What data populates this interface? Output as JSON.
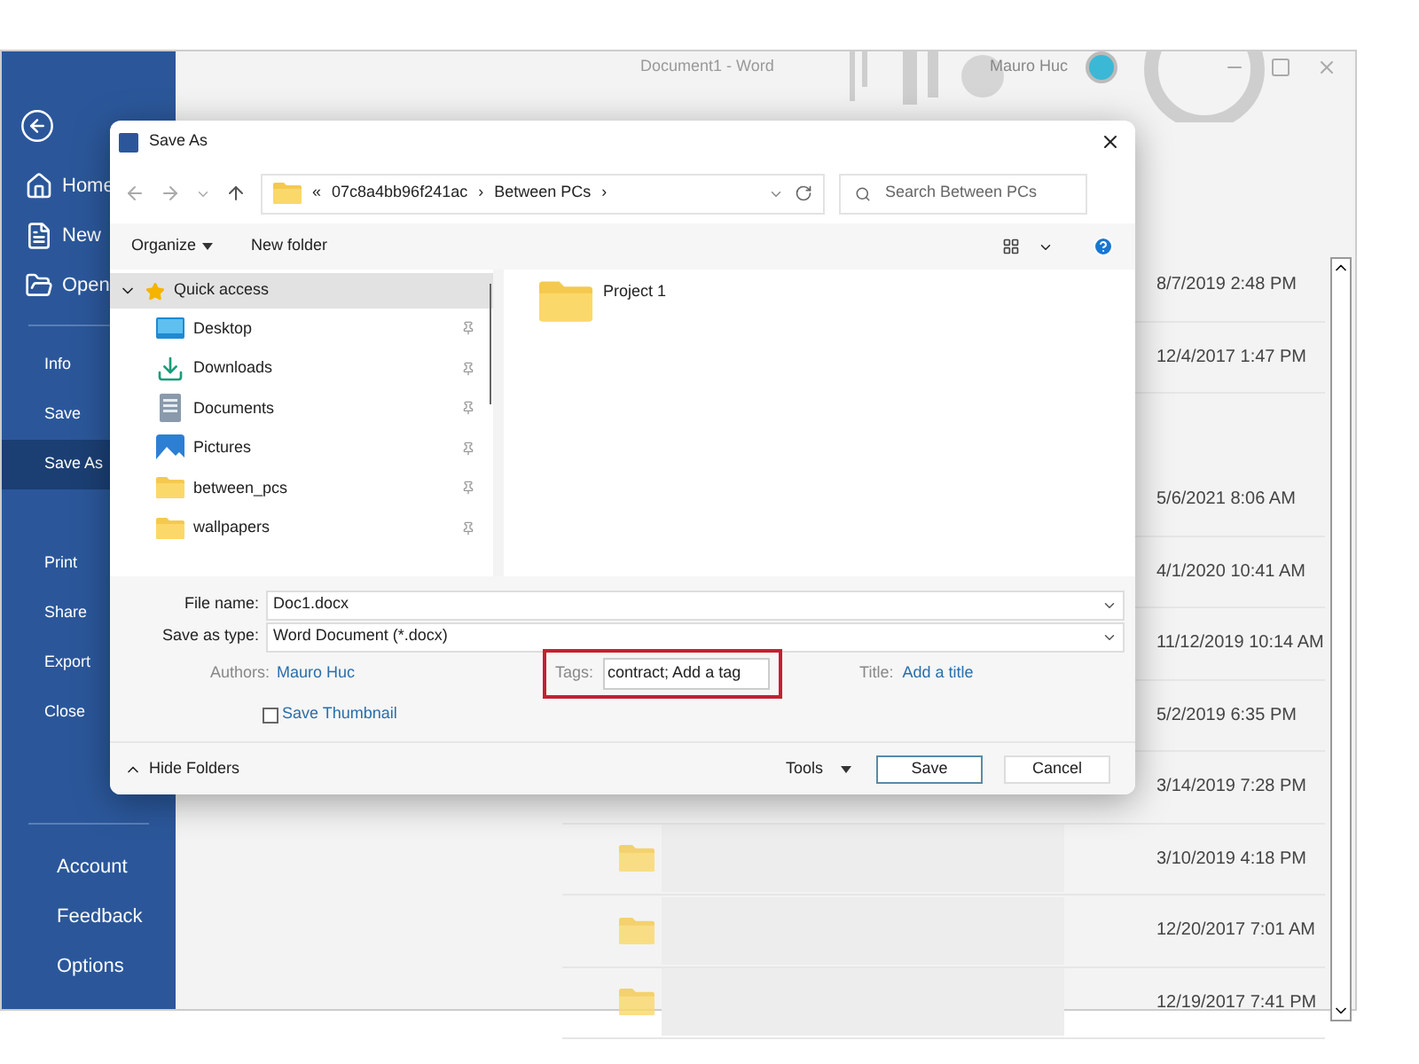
{
  "word": {
    "title": "Document1 - Word",
    "user": "Mauro Huc",
    "nav_top": [
      {
        "label": "Home",
        "kind": "home"
      },
      {
        "label": "New",
        "kind": "new"
      },
      {
        "label": "Open",
        "kind": "open"
      }
    ],
    "nav_middle": [
      {
        "label": "Info",
        "selected": false
      },
      {
        "label": "Save",
        "selected": false
      },
      {
        "label": "Save As",
        "selected": true
      },
      {
        "label": "Print",
        "selected": false
      },
      {
        "label": "Share",
        "selected": false
      },
      {
        "label": "Export",
        "selected": false
      },
      {
        "label": "Close",
        "selected": false
      }
    ],
    "nav_bottom": [
      "Account",
      "Feedback",
      "Options"
    ],
    "recent_first": [
      {
        "date": "8/7/2019 2:48 PM"
      },
      {
        "date": "12/4/2017 1:47 PM"
      }
    ],
    "recent_second": [
      {
        "date": "5/6/2021 8:06 AM"
      },
      {
        "date": "4/1/2020 10:41 AM"
      },
      {
        "date": "11/12/2019 10:14 AM"
      },
      {
        "date": "5/2/2019 6:35 PM"
      },
      {
        "date": "3/14/2019 7:28 PM"
      }
    ],
    "recent_folders": [
      {
        "date": "3/10/2019 4:18 PM"
      },
      {
        "date": "12/20/2017 7:01 AM"
      },
      {
        "date": "12/19/2017 7:41 PM"
      }
    ]
  },
  "dialog": {
    "title": "Save As",
    "path": [
      "«",
      "07c8a4bb96f241ac",
      "›",
      "Between PCs",
      "›"
    ],
    "search": {
      "placeholder": "Search Between PCs"
    },
    "toolbar": [
      "Organize",
      "New folder"
    ],
    "nav": {
      "label": "Quick access",
      "expanded": true,
      "selected": true,
      "children": [
        {
          "label": "Desktop",
          "kind": "desktop"
        },
        {
          "label": "Downloads",
          "kind": "downloads"
        },
        {
          "label": "Documents",
          "kind": "documents"
        },
        {
          "label": "Pictures",
          "kind": "pictures"
        },
        {
          "label": "between_pcs",
          "kind": "folder"
        },
        {
          "label": "wallpapers",
          "kind": "folder"
        }
      ]
    },
    "files": [
      {
        "name": "Project 1"
      }
    ],
    "file_name": {
      "label": "File name:",
      "value": "Doc1.docx"
    },
    "save_type": {
      "label": "Save as type:",
      "value": "Word Document (*.docx)"
    },
    "authors": {
      "label": "Authors:",
      "value": "Mauro Huc"
    },
    "tags": {
      "label": "Tags:",
      "value": "contract; Add a tag",
      "highlighted": true
    },
    "title_field": {
      "label": "Title:",
      "value": "Add a title"
    },
    "thumbnail": {
      "label": "Save Thumbnail",
      "checked": false
    },
    "hide_folders": "Hide Folders",
    "tools": "Tools",
    "buttons": [
      "Save",
      "Cancel"
    ]
  }
}
